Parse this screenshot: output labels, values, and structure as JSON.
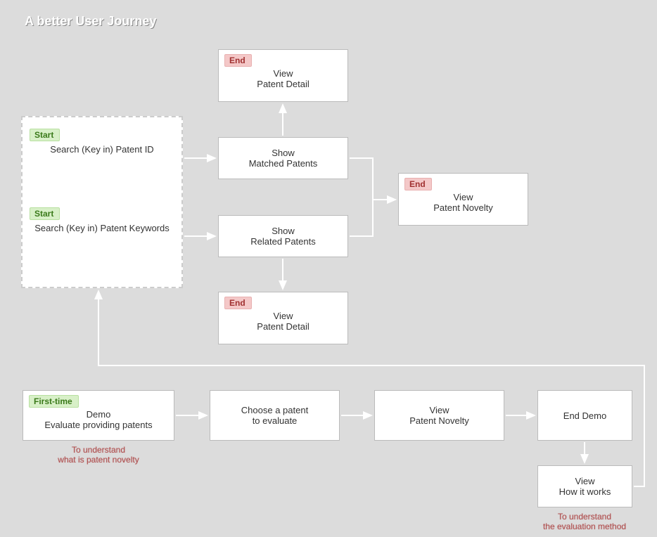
{
  "title": "A better User Journey",
  "badges": {
    "start": "Start",
    "end": "End",
    "firstTime": "First-time"
  },
  "startGroup": {
    "n1": {
      "line1": "Search (Key in)",
      "line2": "Patent ID"
    },
    "n2": {
      "line1": "Search (Key in)",
      "line2": "Patent Keywords"
    }
  },
  "top": {
    "viewDetail1": {
      "line1": "View",
      "line2": "Patent Detail"
    },
    "showMatched": {
      "line1": "Show",
      "line2": "Matched Patents"
    },
    "showRelated": {
      "line1": "Show",
      "line2": "Related Patents"
    },
    "viewNovelty": {
      "line1": "View",
      "line2": "Patent Novelty"
    },
    "viewDetail2": {
      "line1": "View",
      "line2": "Patent Detail"
    }
  },
  "bottom": {
    "demo": {
      "line1": "Demo",
      "line2": "Evaluate providing patents"
    },
    "choose": {
      "line1": "Choose a patent",
      "line2": "to evaluate"
    },
    "novelty": {
      "line1": "View",
      "line2": "Patent Novelty"
    },
    "endDemo": {
      "line1": "End Demo"
    },
    "howItWorks": {
      "line1": "View",
      "line2": "How it works"
    }
  },
  "captions": {
    "c1": {
      "line1": "To understand",
      "line2": "what is patent novelty"
    },
    "c2": {
      "line1": "To understand",
      "line2": "the evaluation method"
    }
  }
}
